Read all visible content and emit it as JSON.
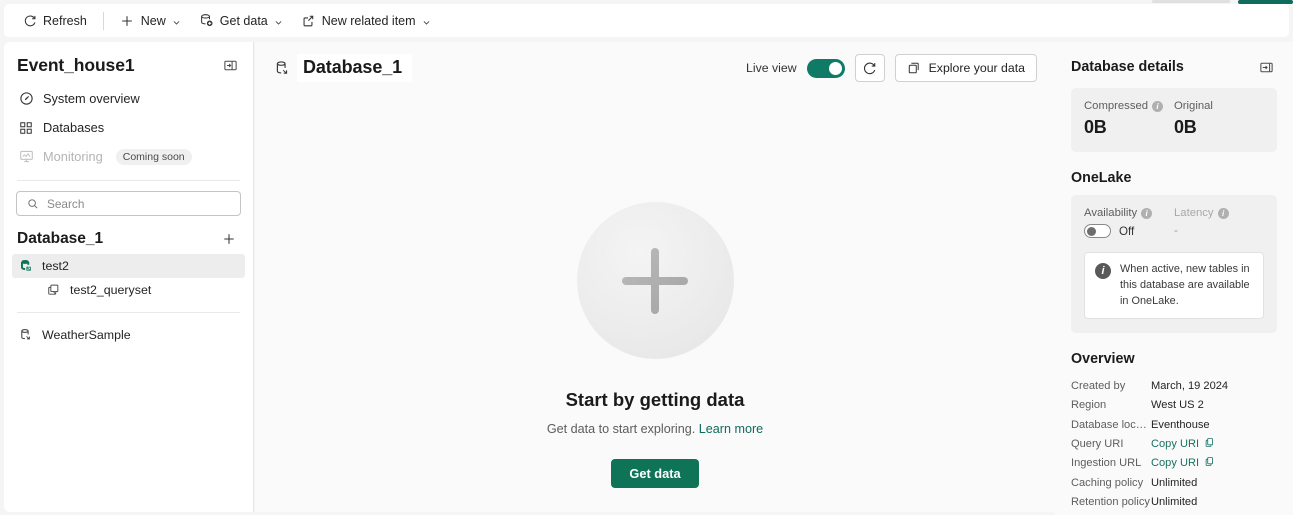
{
  "toolbar": {
    "refresh": "Refresh",
    "new": "New",
    "get_data": "Get data",
    "new_related_item": "New related item"
  },
  "sidebar": {
    "title": "Event_house1",
    "collapse_tooltip": "Collapse",
    "nav": [
      {
        "label": "System overview",
        "icon": "gauge-icon",
        "disabled": false,
        "badge": ""
      },
      {
        "label": "Databases",
        "icon": "grid-icon",
        "disabled": false,
        "badge": ""
      },
      {
        "label": "Monitoring",
        "icon": "monitor-icon",
        "disabled": true,
        "badge": "Coming soon"
      }
    ],
    "search_placeholder": "Search",
    "search_value": "",
    "db_section_title": "Database_1",
    "add_tooltip": "Add",
    "tree": [
      {
        "label": "test2",
        "level": 1,
        "icon": "database-table-icon",
        "selected": true
      },
      {
        "label": "test2_queryset",
        "level": 2,
        "icon": "queryset-icon",
        "selected": false
      }
    ],
    "tree_bottom": [
      {
        "label": "WeatherSample",
        "level": 0,
        "icon": "database-icon",
        "selected": false
      }
    ]
  },
  "center": {
    "db_title": "Database_1",
    "live_view_label": "Live view",
    "live_view_on": true,
    "refresh_tooltip": "Refresh",
    "explore_label": "Explore your data",
    "empty_title": "Start by getting data",
    "empty_sub_text": "Get data to start exploring.",
    "empty_sub_link": "Learn more",
    "get_data_button": "Get data"
  },
  "details": {
    "header": "Database details",
    "expand_tooltip": "Expand",
    "size_card": {
      "compressed_label": "Compressed",
      "compressed_value": "0B",
      "original_label": "Original",
      "original_value": "0B"
    },
    "onelake": {
      "section_title": "OneLake",
      "availability_label": "Availability",
      "availability_value": "Off",
      "latency_label": "Latency",
      "latency_value": "-",
      "info_text": "When active, new tables in this database are available in OneLake."
    },
    "overview": {
      "section_title": "Overview",
      "rows": [
        {
          "key": "Created by",
          "value": "March, 19 2024",
          "link": false,
          "copy": false
        },
        {
          "key": "Region",
          "value": "West US 2",
          "link": false,
          "copy": false
        },
        {
          "key": "Database locati...",
          "value": "Eventhouse",
          "link": false,
          "copy": false
        },
        {
          "key": "Query URI",
          "value": "Copy URI",
          "link": true,
          "copy": true
        },
        {
          "key": "Ingestion URL",
          "value": "Copy URI",
          "link": true,
          "copy": true
        },
        {
          "key": "Caching policy",
          "value": "Unlimited",
          "link": false,
          "copy": false
        },
        {
          "key": "Retention policy",
          "value": "Unlimited",
          "link": false,
          "copy": false
        }
      ]
    }
  },
  "colors": {
    "accent_teal": "#0f7358",
    "toggle_on": "#0f7b66",
    "link_teal": "#1a7263",
    "db_icon_green": "#0f7358"
  }
}
